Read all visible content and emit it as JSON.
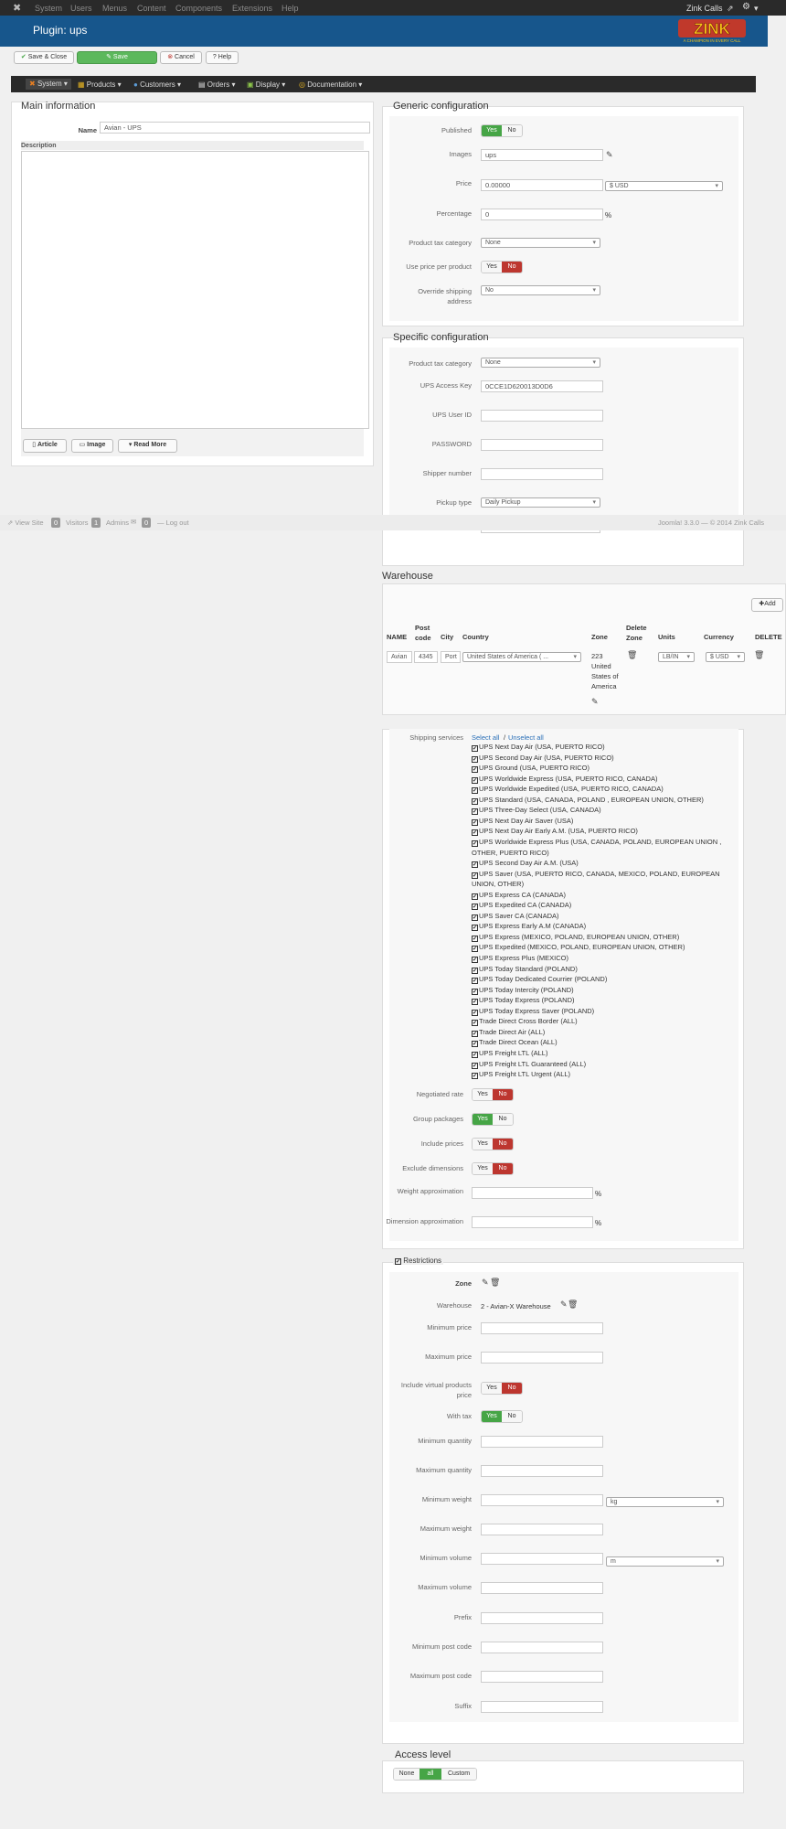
{
  "topbar": {
    "menu": [
      "System",
      "Users",
      "Menus",
      "Content",
      "Components",
      "Extensions",
      "Help"
    ],
    "site_name": "Zink Calls",
    "settings_icon": "gear-icon"
  },
  "header": {
    "title": "Plugin: ups",
    "logo_text": "ZINK",
    "logo_tagline": "A CHAMPION IN EVERY CALL"
  },
  "toolbar": {
    "save_close": "Save & Close",
    "save": "Save",
    "cancel": "Cancel",
    "help": "Help"
  },
  "hika_menu": [
    "System",
    "Products",
    "Customers",
    "Orders",
    "Display",
    "Documentation"
  ],
  "main": {
    "title": "Main information",
    "name_label": "Name",
    "name_value": "Avian - UPS",
    "description_label": "Description",
    "article_btn": "Article",
    "image_btn": "Image",
    "readmore_btn": "Read More"
  },
  "generic": {
    "title": "Generic configuration",
    "published_label": "Published",
    "images_label": "Images",
    "images_value": "ups",
    "price_label": "Price",
    "price_value": "0.00000",
    "currency_value": "$ USD",
    "percentage_label": "Percentage",
    "percentage_value": "0",
    "percent_sign": "%",
    "tax_label": "Product tax category",
    "tax_value": "None",
    "use_price_label": "Use price per product",
    "override_label": "Override shipping address",
    "override_value": "No",
    "yes": "Yes",
    "no": "No"
  },
  "specific": {
    "title": "Specific configuration",
    "tax_label": "Product tax category",
    "tax_value": "None",
    "access_key_label": "UPS Access Key",
    "access_key_value": "0CCE1D620013D0D6",
    "user_id_label": "UPS User ID",
    "password_label": "PASSWORD",
    "shipper_label": "Shipper number",
    "pickup_label": "Pickup type",
    "pickup_value": "Daily Pickup"
  },
  "footer": {
    "view_site": "View Site",
    "visitors_count": "0",
    "visitors": "Visitors",
    "admins_count": "1",
    "admins": "Admins",
    "mail_count": "0",
    "logout": "Log out",
    "copyright": "Joomla! 3.3.0 — © 2014 Zink Calls"
  },
  "warehouse": {
    "title": "Warehouse",
    "add_btn": "Add",
    "headers": [
      "NAME",
      "Post code",
      "City",
      "Country",
      "Zone",
      "Delete Zone",
      "Units",
      "Currency",
      "DELETE"
    ],
    "row": {
      "name": "Avian",
      "post": "4345",
      "city": "Port",
      "country": "United States of America ( ...",
      "zone": "223 United States of America",
      "units": "LB/IN",
      "currency": "$ USD"
    }
  },
  "shipping": {
    "label": "Shipping services",
    "select_all": "Select all",
    "sep": "/",
    "unselect_all": "Unselect all",
    "services": [
      "UPS Next Day Air (USA, PUERTO RICO)",
      "UPS Second Day Air (USA, PUERTO RICO)",
      "UPS Ground (USA, PUERTO RICO)",
      "UPS Worldwide Express (USA, PUERTO RICO, CANADA)",
      "UPS Worldwide Expedited (USA, PUERTO RICO, CANADA)",
      "UPS Standard (USA, CANADA, POLAND , EUROPEAN UNION, OTHER)",
      "UPS Three-Day Select (USA, CANADA)",
      "UPS Next Day Air Saver (USA)",
      "UPS Next Day Air Early A.M. (USA, PUERTO RICO)",
      "UPS Worldwide Express Plus (USA, CANADA, POLAND, EUROPEAN UNION ,",
      "OTHER, PUERTO RICO)",
      "UPS Second Day Air A.M. (USA)",
      "UPS Saver (USA, PUERTO RICO, CANADA, MEXICO, POLAND, EUROPEAN",
      "UNION, OTHER)",
      "UPS Express CA (CANADA)",
      "UPS Expedited CA (CANADA)",
      "UPS Saver CA (CANADA)",
      "UPS Express Early A.M (CANADA)",
      "UPS Express (MEXICO, POLAND, EUROPEAN UNION, OTHER)",
      "UPS Expedited (MEXICO, POLAND, EUROPEAN UNION, OTHER)",
      "UPS Express Plus (MEXICO)",
      "UPS Today Standard (POLAND)",
      "UPS Today Dedicated Courrier (POLAND)",
      "UPS Today Intercity (POLAND)",
      "UPS Today Express (POLAND)",
      "UPS Today Express Saver (POLAND)",
      "Trade Direct Cross Border (ALL)",
      "Trade Direct Air (ALL)",
      "Trade Direct Ocean (ALL)",
      "UPS Freight LTL (ALL)",
      "UPS Freight LTL Guaranteed (ALL)",
      "UPS Freight LTL Urgent (ALL)"
    ],
    "negotiated_label": "Negotiated rate",
    "group_label": "Group packages",
    "include_prices_label": "Include prices",
    "exclude_dims_label": "Exclude dimensions",
    "weight_approx_label": "Weight approximation",
    "dim_approx_label": "Dimension approximation",
    "percent_sign": "%"
  },
  "restrictions": {
    "title": "Restrictions",
    "zone_label": "Zone",
    "warehouse_label": "Warehouse",
    "warehouse_value": "2 - Avian-X Warehouse",
    "min_price": "Minimum price",
    "max_price": "Maximum price",
    "include_virtual": "Include virtual products price",
    "with_tax": "With tax",
    "min_qty": "Minimum quantity",
    "max_qty": "Maximum quantity",
    "min_weight": "Minimum weight",
    "weight_unit": "kg",
    "max_weight": "Maximum weight",
    "min_volume": "Minimum volume",
    "volume_unit": "m",
    "max_volume": "Maximum volume",
    "prefix": "Prefix",
    "min_post": "Minimum post code",
    "max_post": "Maximum post code",
    "suffix": "Suffix"
  },
  "access": {
    "title": "Access level",
    "none": "None",
    "all": "all",
    "custom": "Custom"
  },
  "colors": {
    "header": "#17568c",
    "green": "#46a546",
    "red": "#bd362f",
    "topbar": "#2a2a2a"
  }
}
